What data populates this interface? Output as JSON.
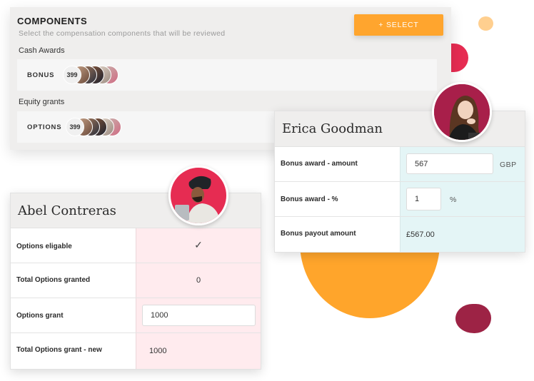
{
  "components": {
    "title": "COMPONENTS",
    "subtitle": "Select the compensation components that will be reviewed",
    "select_button": "+ SELECT",
    "groups": [
      {
        "label": "Cash Awards",
        "row_label": "BONUS",
        "count": "399"
      },
      {
        "label": "Equity grants",
        "row_label": "OPTIONS",
        "count": "399"
      }
    ]
  },
  "erica": {
    "name": "Erica Goodman",
    "rows": [
      {
        "label": "Bonus award - amount",
        "value": "567",
        "unit": "GBP"
      },
      {
        "label": "Bonus award - %",
        "value": "1",
        "unit": "%"
      },
      {
        "label": "Bonus payout amount",
        "value": "£567.00"
      }
    ]
  },
  "abel": {
    "name": "Abel Contreras",
    "rows": [
      {
        "label": "Options eligable",
        "value": "✓"
      },
      {
        "label": "Total Options granted",
        "value": "0"
      },
      {
        "label": "Options grant",
        "value": "1000"
      },
      {
        "label": "Total Options grant - new",
        "value": "1000"
      }
    ]
  },
  "colors": {
    "accent_orange": "#ffa52e",
    "accent_red": "#e62c52",
    "crimson": "#9d2345",
    "peach": "#ffcf8f",
    "erica_value_bg": "#e4f5f6",
    "abel_value_bg": "#ffebee"
  }
}
